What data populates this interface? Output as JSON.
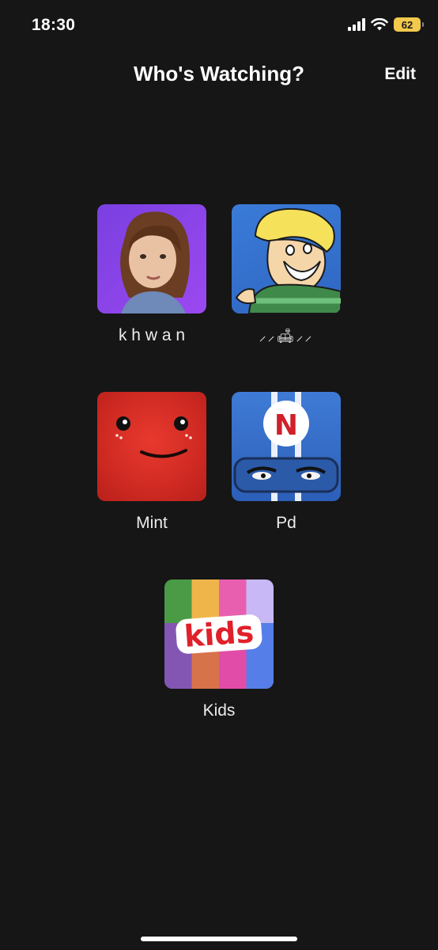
{
  "status_bar": {
    "time": "18:30",
    "battery": "62",
    "icons": [
      "signal-icon",
      "wifi-icon",
      "battery-icon"
    ]
  },
  "header": {
    "title": "Who's Watching?",
    "edit_label": "Edit"
  },
  "profiles": [
    {
      "name": "k h w a n",
      "avatar": "portrait-avatar",
      "color": "#8a45e8"
    },
    {
      "name": "⸝⸝🛋⸝⸝",
      "avatar": "cartoon-avatar",
      "color": "#3571cf"
    },
    {
      "name": "Mint",
      "avatar": "red-monster-avatar",
      "color": "#d42c24"
    },
    {
      "name": "Pd",
      "avatar": "n-helmet-avatar",
      "color": "#3a72cf"
    },
    {
      "name": "Kids",
      "avatar": "kids-avatar",
      "logo_text": "kids",
      "color": "#e0202a"
    }
  ],
  "theme": {
    "background": "#161616",
    "text": "#ffffff",
    "battery": "#f2c94c"
  }
}
